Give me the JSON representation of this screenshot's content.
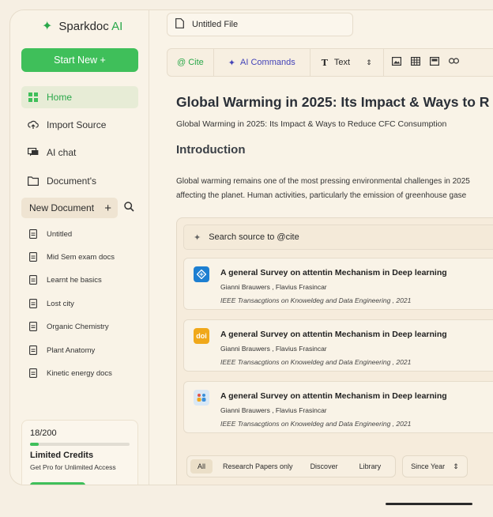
{
  "app": {
    "name_main": "Sparkdoc",
    "name_ai": "AI"
  },
  "sidebar": {
    "start_new": "Start New +",
    "nav": [
      {
        "label": "Home",
        "icon": "grid-icon",
        "active": true
      },
      {
        "label": "Import Source",
        "icon": "cloud-upload-icon"
      },
      {
        "label": "AI chat",
        "icon": "chat-icon"
      },
      {
        "label": "Document's",
        "icon": "folder-icon"
      }
    ],
    "new_document": "New Document",
    "new_document_plus": "+",
    "documents": [
      "Untitled",
      "Mid Sem exam docs",
      "Learnt he basics",
      "Lost city",
      "Organic Chemistry",
      "Plant Anatomy",
      "Kinetic energy docs"
    ],
    "credits": {
      "count": "18/200",
      "progress": 0.09,
      "title": "Limited Credits",
      "subtitle": "Get Pro for Unlimited Access"
    }
  },
  "file": {
    "name": "Untitled File"
  },
  "toolbar": {
    "cite": "@ Cite",
    "ai_commands": "AI Commands",
    "text_style": "Text"
  },
  "document": {
    "title": "Global Warming in 2025: Its Impact & Ways to R",
    "subtitle": "Global Warming in 2025: Its Impact & Ways to Reduce CFC Consumption",
    "heading": "Introduction",
    "para_line1": "Global warming remains one of the most pressing environmental challenges in 2025",
    "para_line2": "affecting the planet. Human activities, particularly the emission of greenhouse gase"
  },
  "cite_panel": {
    "search_placeholder": "Search source to @cite",
    "results": [
      {
        "title": "A general Survey on attentin Mechanism in Deep learning",
        "authors": "Gianni Brauwers , Flavius Frasincar",
        "journal": "IEEE Transacgtions on Knoweldeg and Data Engineering , 2021",
        "source_icon": "diamond-source-icon",
        "color": "#1d7fd1"
      },
      {
        "title": "A general Survey on attentin Mechanism in Deep learning",
        "authors": "Gianni Brauwers , Flavius Frasincar",
        "journal": "IEEE Transacgtions on Knoweldeg and Data Engineering , 2021",
        "source_icon": "doi-icon",
        "color": "#f0a81a",
        "badge": "doi"
      },
      {
        "title": "A general Survey on attentin Mechanism in Deep learning",
        "authors": "Gianni Brauwers , Flavius Frasincar",
        "journal": "IEEE Transacgtions on Knoweldeg and Data Engineering , 2021",
        "source_icon": "people-source-icon",
        "color": "#3b8fd9"
      }
    ],
    "filters": [
      "All",
      "Research Papers only",
      "Discover",
      "Library"
    ],
    "since": "Since Year"
  }
}
